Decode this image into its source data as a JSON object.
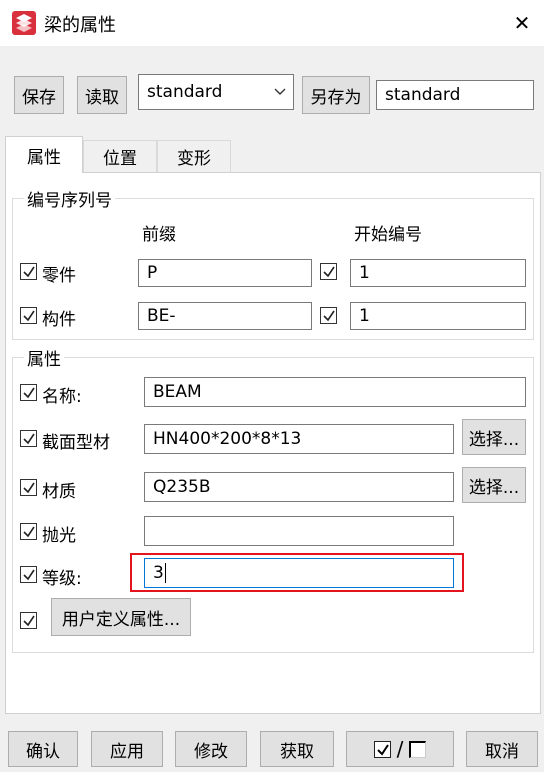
{
  "window": {
    "title": "梁的属性",
    "close_label": "✕"
  },
  "colors": {
    "highlight": "#e4141e",
    "focus": "#0078d7",
    "icon": "#d9303e"
  },
  "toolbar": {
    "save_label": "保存",
    "load_label": "读取",
    "preset_value": "standard",
    "save_as_label": "另存为",
    "save_as_value": "standard"
  },
  "tabs": [
    {
      "label": "属性",
      "active": true
    },
    {
      "label": "位置",
      "active": false
    },
    {
      "label": "变形",
      "active": false
    }
  ],
  "numbering": {
    "group_title": "编号序列号",
    "prefix_header": "前缀",
    "start_header": "开始编号",
    "rows": [
      {
        "label": "零件",
        "checked": true,
        "prefix": "P",
        "start_checked": true,
        "start": "1"
      },
      {
        "label": "构件",
        "checked": true,
        "prefix": "BE-",
        "start_checked": true,
        "start": "1"
      }
    ]
  },
  "attributes": {
    "group_title": "属性",
    "name_label": "名称:",
    "name_value": "BEAM",
    "profile_label": "截面型材",
    "profile_value": "HN400*200*8*13",
    "profile_select": "选择...",
    "material_label": "材质",
    "material_value": "Q235B",
    "material_select": "选择...",
    "finish_label": "抛光",
    "finish_value": "",
    "class_label": "等级:",
    "class_value": "3",
    "udf_button": "用户定义属性..."
  },
  "footer": {
    "ok": "确认",
    "apply": "应用",
    "modify": "修改",
    "get": "获取",
    "toggle_slash": "/",
    "cancel": "取消"
  }
}
